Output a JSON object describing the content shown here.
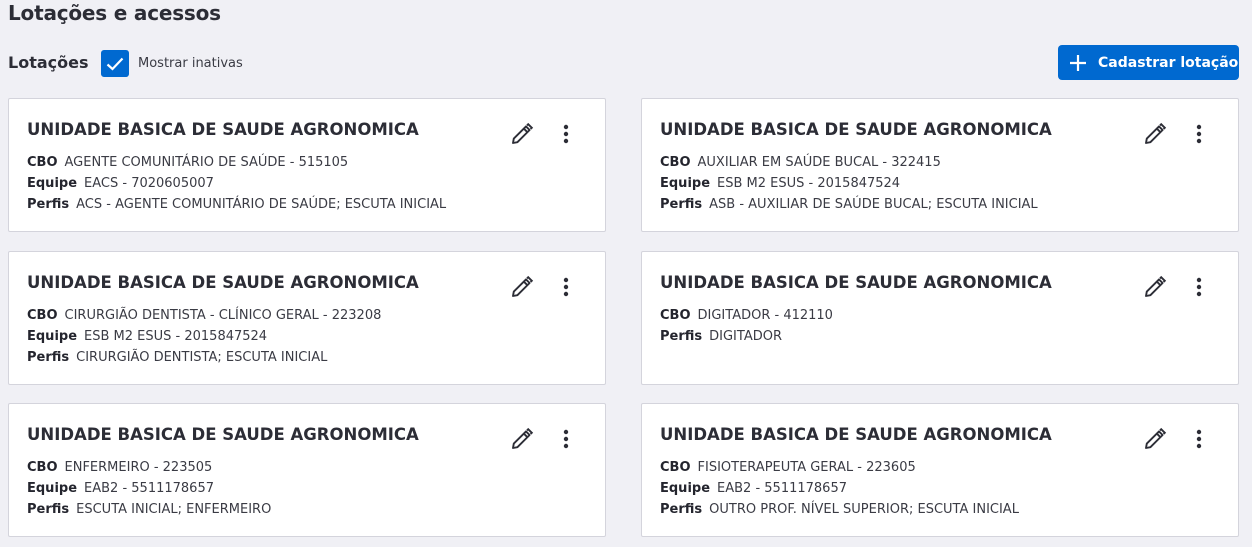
{
  "page": {
    "title": "Lotações e acessos"
  },
  "lotacoes": {
    "section_title": "Lotações",
    "show_inactive_label": "Mostrar inativas",
    "show_inactive_checked": true,
    "add_button_label": "Cadastrar lotação"
  },
  "labels": {
    "cbo": "CBO",
    "equipe": "Equipe",
    "perfis": "Perfis"
  },
  "colors": {
    "primary": "#0069d0",
    "background": "#f0f0f5",
    "card": "#ffffff"
  },
  "cards": [
    {
      "title": "UNIDADE BASICA DE SAUDE AGRONOMICA",
      "cbo": "AGENTE COMUNITÁRIO DE SAÚDE - 515105",
      "equipe": "EACS - 7020605007",
      "perfis": "ACS - AGENTE COMUNITÁRIO DE SAÚDE; ESCUTA INICIAL"
    },
    {
      "title": "UNIDADE BASICA DE SAUDE AGRONOMICA",
      "cbo": "AUXILIAR EM SAÚDE BUCAL - 322415",
      "equipe": "ESB M2 ESUS - 2015847524",
      "perfis": "ASB - AUXILIAR DE SAÚDE BUCAL; ESCUTA INICIAL"
    },
    {
      "title": "UNIDADE BASICA DE SAUDE AGRONOMICA",
      "cbo": "CIRURGIÃO DENTISTA - CLÍNICO GERAL - 223208",
      "equipe": "ESB M2 ESUS - 2015847524",
      "perfis": "CIRURGIÃO DENTISTA; ESCUTA INICIAL"
    },
    {
      "title": "UNIDADE BASICA DE SAUDE AGRONOMICA",
      "cbo": "DIGITADOR - 412110",
      "equipe": null,
      "perfis": "DIGITADOR"
    },
    {
      "title": "UNIDADE BASICA DE SAUDE AGRONOMICA",
      "cbo": "ENFERMEIRO - 223505",
      "equipe": "EAB2 - 5511178657",
      "perfis": "ESCUTA INICIAL; ENFERMEIRO"
    },
    {
      "title": "UNIDADE BASICA DE SAUDE AGRONOMICA",
      "cbo": "FISIOTERAPEUTA GERAL - 223605",
      "equipe": "EAB2 - 5511178657",
      "perfis": "OUTRO PROF. NÍVEL SUPERIOR; ESCUTA INICIAL"
    }
  ]
}
